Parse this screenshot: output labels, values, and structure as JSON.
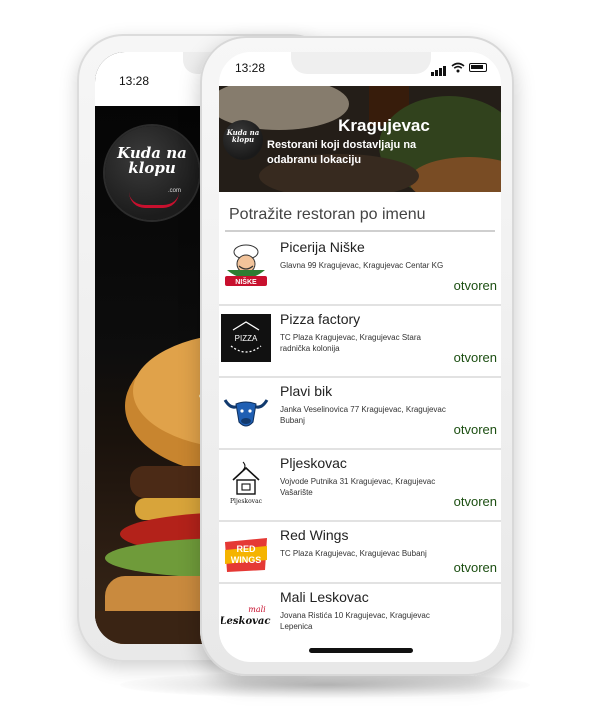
{
  "back_phone": {
    "time": "13:28",
    "logo_text": "Kuda na klopu",
    "logo_dotcom": ".com"
  },
  "front_phone": {
    "time": "13:28",
    "header": {
      "city": "Kragujevac",
      "subtitle": "Restorani koji dostavljaju na odabranu lokaciju",
      "logo_text": "Kuda na klopu"
    },
    "search": {
      "placeholder": "Potražite restoran po imenu"
    },
    "restaurants": [
      {
        "name": "Picerija Niške",
        "address": "Glavna 99 Kragujevac, Kragujevac Centar KG",
        "status": "otvoren",
        "logo": "nishke-chef-logo"
      },
      {
        "name": "Pizza factory",
        "address": "TC Plaza Kragujevac, Kragujevac Stara radnička kolonija",
        "status": "otvoren",
        "logo": "pizza-factory-logo"
      },
      {
        "name": "Plavi bik",
        "address": "Janka Veselinovica 77 Kragujevac, Kragujevac Bubanj",
        "status": "otvoren",
        "logo": "blue-bull-logo"
      },
      {
        "name": "Pljeskovac",
        "address": "Vojvode Putnika 31 Kragujevac, Kragujevac Vašarište",
        "status": "otvoren",
        "logo": "pljeskovac-house-logo"
      },
      {
        "name": "Red Wings",
        "address": "TC Plaza Kragujevac, Kragujevac Bubanj",
        "status": "otvoren",
        "logo": "red-wings-logo"
      },
      {
        "name": "Mali Leskovac",
        "address": "Jovana Ristića 10 Kragujevac, Kragujevac Lepenica",
        "status": "",
        "logo": "mali-leskovac-logo"
      }
    ],
    "logo_labels": {
      "nishke": "NIŠKE",
      "pizza": "PIZZA",
      "pljeskovac": "Pljeskovac",
      "redwings_line1": "RED",
      "redwings_line2": "WINGS",
      "mali": "mali",
      "leskovac": "Leskovac"
    }
  },
  "colors": {
    "status_open": "#1c4f12",
    "brand_red": "#c8102e",
    "bull_blue": "#1f5fb3"
  }
}
